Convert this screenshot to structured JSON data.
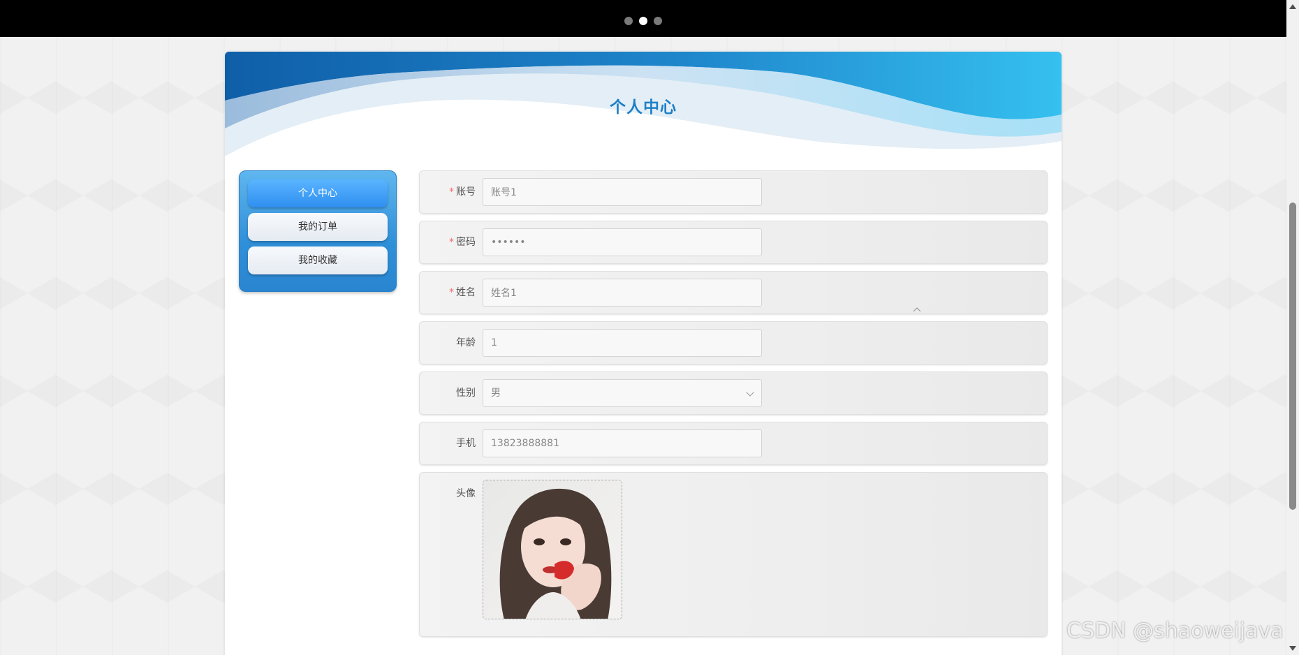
{
  "carousel": {
    "dots": 3,
    "active_dot": 2
  },
  "page_title": "个人中心",
  "side_menu": {
    "items": [
      {
        "label": "个人中心",
        "active": true
      },
      {
        "label": "我的订单",
        "active": false
      },
      {
        "label": "我的收藏",
        "active": false
      }
    ]
  },
  "form": {
    "account": {
      "label": "账号",
      "required": true,
      "value": "账号1"
    },
    "password": {
      "label": "密码",
      "required": true,
      "value": "••••••"
    },
    "name": {
      "label": "姓名",
      "required": true,
      "value": "姓名1"
    },
    "age": {
      "label": "年龄",
      "required": false,
      "value": "1"
    },
    "gender": {
      "label": "性别",
      "required": false,
      "value": "男"
    },
    "phone": {
      "label": "手机",
      "required": false,
      "value": "13823888881"
    },
    "avatar": {
      "label": "头像",
      "required": false,
      "icon": "avatar-photo"
    }
  },
  "watermark": "CSDN @shaoweijava",
  "colors": {
    "accent": "#1e7fc6",
    "menu_active": "#3a9cf5",
    "required_mark": "#f56c6c"
  }
}
